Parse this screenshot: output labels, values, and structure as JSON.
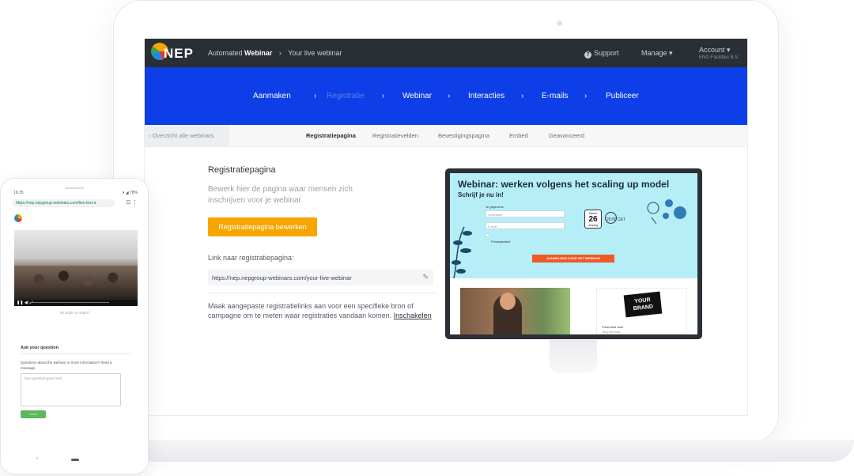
{
  "laptop": {
    "topbar": {
      "logo_text": "NEP",
      "crumb_prefix": "Automated",
      "crumb_bold": "Webinar",
      "crumb_sep": "›",
      "crumb_current": "Your live webinar",
      "support_label": "Support",
      "manage_label": "Manage",
      "account_label": "Account",
      "account_org": "ENG Facilities B.V.",
      "caret": "▾"
    },
    "wizard": {
      "steps": [
        "Aanmaken",
        "Registratie",
        "Webinar",
        "Interacties",
        "E-mails",
        "Publiceer"
      ],
      "active_index": 1,
      "chevron": "›"
    },
    "subtabs": {
      "back_label": "Overzicht alle webinars",
      "back_arrow": "‹",
      "tabs": [
        "Registratiepagina",
        "Registratievelden",
        "Bevestigingspagina",
        "Embed",
        "Geavanceerd"
      ],
      "active_index": 0
    },
    "main": {
      "title": "Registratiepagina",
      "description": "Bewerk hier de pagina waar mensen zich inschrijven voor je webinar.",
      "edit_button": "Registratiepagina bewerken",
      "link_label": "Link naar registratiepagina:",
      "registration_url": "https://nep.nepgroup-webinars.com/your-live-webinar",
      "custom_note": "Maak aangepaste registratielinks aan voor een specifieke bron of campagne om te meten waar registraties vandaan komen.",
      "custom_link": "Inschakelen"
    },
    "preview": {
      "title": "Webinar: werken volgens het scaling up model",
      "subtitle": "Schrijf je nu in!",
      "form_label": "Je gegevens",
      "input_name": "Voornaam",
      "input_email": "E-mail",
      "privacy": "Privacybeleid",
      "cal_month": "Maand",
      "cal_day": "26",
      "cal_weekday": "dinsdag",
      "time": "20:00 CET",
      "cta": "AANMELDEN VOOR HET WEBINAR",
      "brand_line1": "YOUR",
      "brand_line2": "BRAND",
      "presented_by": "Presented door",
      "presenter": "Tony Bennett"
    },
    "colors": {
      "wizard_bg": "#0d3ee8",
      "topbar_bg": "#2a2f36",
      "accent_orange": "#f7a600",
      "preview_hero": "#b6eef7"
    }
  },
  "phone": {
    "status_time": "16:15",
    "status_right": "▾ ◢ 78%",
    "address": "https://nep.nepgroup-webinars.com/live-test-a",
    "addr_icons": "⊡ ⋮",
    "controls": "❚❚  ◀)  ⤢",
    "no_audio": "No audio or video?",
    "ask_title": "Ask your question",
    "message": "Questions about the webinar or more information? Send a message.",
    "textarea_placeholder": "Your question goes here",
    "send_button": "send",
    "nav_back": "‹"
  }
}
